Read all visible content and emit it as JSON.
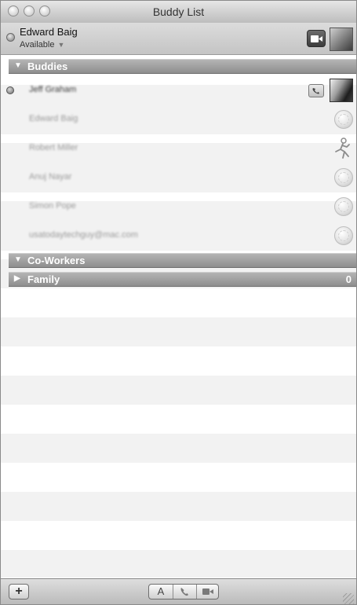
{
  "window": {
    "title": "Buddy List"
  },
  "me": {
    "name": "Edward Baig",
    "status": "Available"
  },
  "groups": {
    "buddies": {
      "name": "Buddies"
    },
    "coworkers": {
      "name": "Co-Workers"
    },
    "family": {
      "name": "Family",
      "count": "0"
    }
  },
  "buddies": [
    {
      "name": "Jeff Graham",
      "online": true
    },
    {
      "name": "Edward Baig",
      "online": false
    },
    {
      "name": "Robert Miller",
      "online": false
    },
    {
      "name": "Anuj Nayar",
      "online": false
    },
    {
      "name": "Simon Pope",
      "online": false
    },
    {
      "name": "usatodaytechguy@mac.com",
      "online": false
    }
  ],
  "toolbar": {
    "text_chat_label": "A"
  },
  "icons": {
    "status": "status-dot-icon",
    "video": "video-camera-icon",
    "phone": "phone-icon",
    "globe": "globe-buddy-icon",
    "aim": "aim-running-man-icon",
    "add": "plus-icon",
    "resize": "resize-grip-icon"
  },
  "colors": {
    "header_bg": "#9f9f9f",
    "alt_row": "#f2f2f2"
  }
}
